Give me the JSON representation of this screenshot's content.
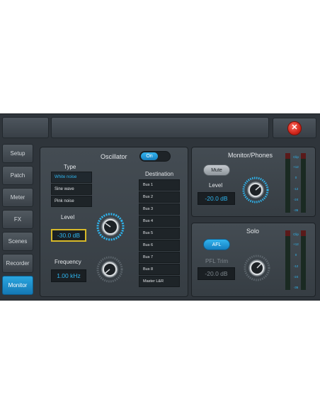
{
  "header": {
    "close_icon": "close-icon",
    "close_glyph": "✕"
  },
  "nav": {
    "items": [
      {
        "label": "Setup",
        "active": false
      },
      {
        "label": "Patch",
        "active": false
      },
      {
        "label": "Meter",
        "active": false
      },
      {
        "label": "FX",
        "active": false
      },
      {
        "label": "Scenes",
        "active": false
      },
      {
        "label": "Recorder",
        "active": false
      },
      {
        "label": "Monitor",
        "active": true
      }
    ]
  },
  "oscillator": {
    "title": "Oscillator",
    "toggle_label": "On",
    "type_label": "Type",
    "types": [
      "White noise",
      "Sine wave",
      "Pink noise"
    ],
    "selected_type": "White noise",
    "level_label": "Level",
    "level_value": "-30.0 dB",
    "frequency_label": "Frequency",
    "frequency_value": "1.00 kHz",
    "destination_label": "Destination",
    "destinations": [
      "Bus 1",
      "Bus 2",
      "Bus 3",
      "Bus 4",
      "Bus 5",
      "Bus 6",
      "Bus 7",
      "Bus 8",
      "Master L&R"
    ]
  },
  "monitor_phones": {
    "title": "Monitor/Phones",
    "mute_label": "Mute",
    "level_label": "Level",
    "level_value": "-20.0 dB"
  },
  "solo": {
    "title": "Solo",
    "afl_label": "AFL",
    "pfl_trim_label": "PFL Trim",
    "pfl_trim_value": "-20.0 dB"
  },
  "meter_scale": [
    "Clip",
    "+12",
    "0",
    "-12",
    "-24",
    "-36"
  ],
  "colors": {
    "accent": "#2eb6f0",
    "highlight": "#d8b928",
    "close": "#d1271c"
  }
}
